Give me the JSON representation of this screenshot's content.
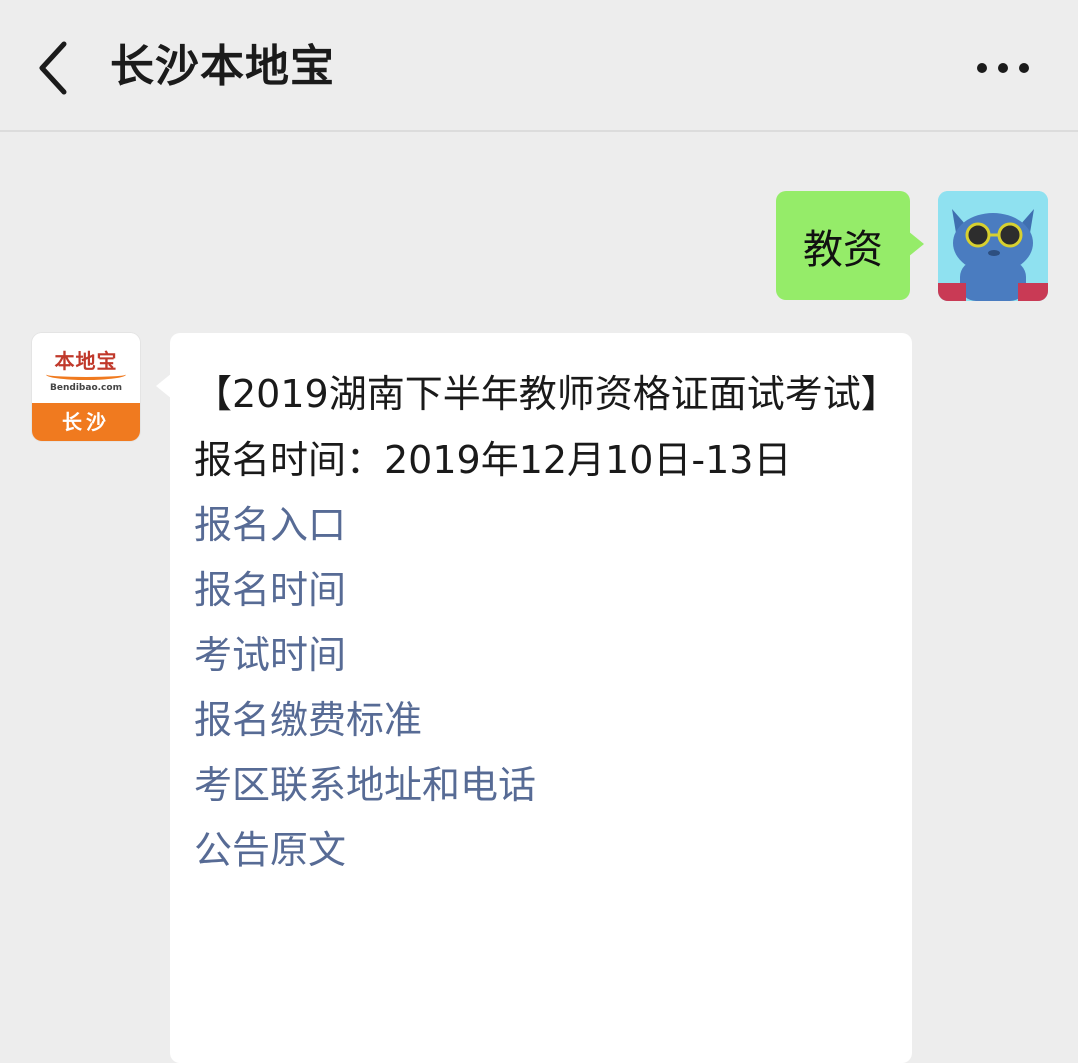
{
  "header": {
    "title": "长沙本地宝",
    "back_icon": "chevron-left-icon",
    "more_icon": "more-horizontal-icon"
  },
  "outgoing_message": {
    "text": "教资"
  },
  "bot_avatar": {
    "logo_text": "本地宝",
    "logo_site": "Bendibao.com",
    "logo_city": "长沙"
  },
  "incoming_message": {
    "title": "【2019湖南下半年教师资格证面试考试】",
    "registration_time": "报名时间：2019年12月10日-13日",
    "links": [
      "报名入口",
      "报名时间",
      "考试时间",
      "报名缴费标准",
      "考区联系地址和电话",
      "公告原文"
    ]
  },
  "colors": {
    "background": "#ededed",
    "outgoing_bubble": "#95ec69",
    "link": "#576b95",
    "brand_orange": "#f07a1f"
  }
}
